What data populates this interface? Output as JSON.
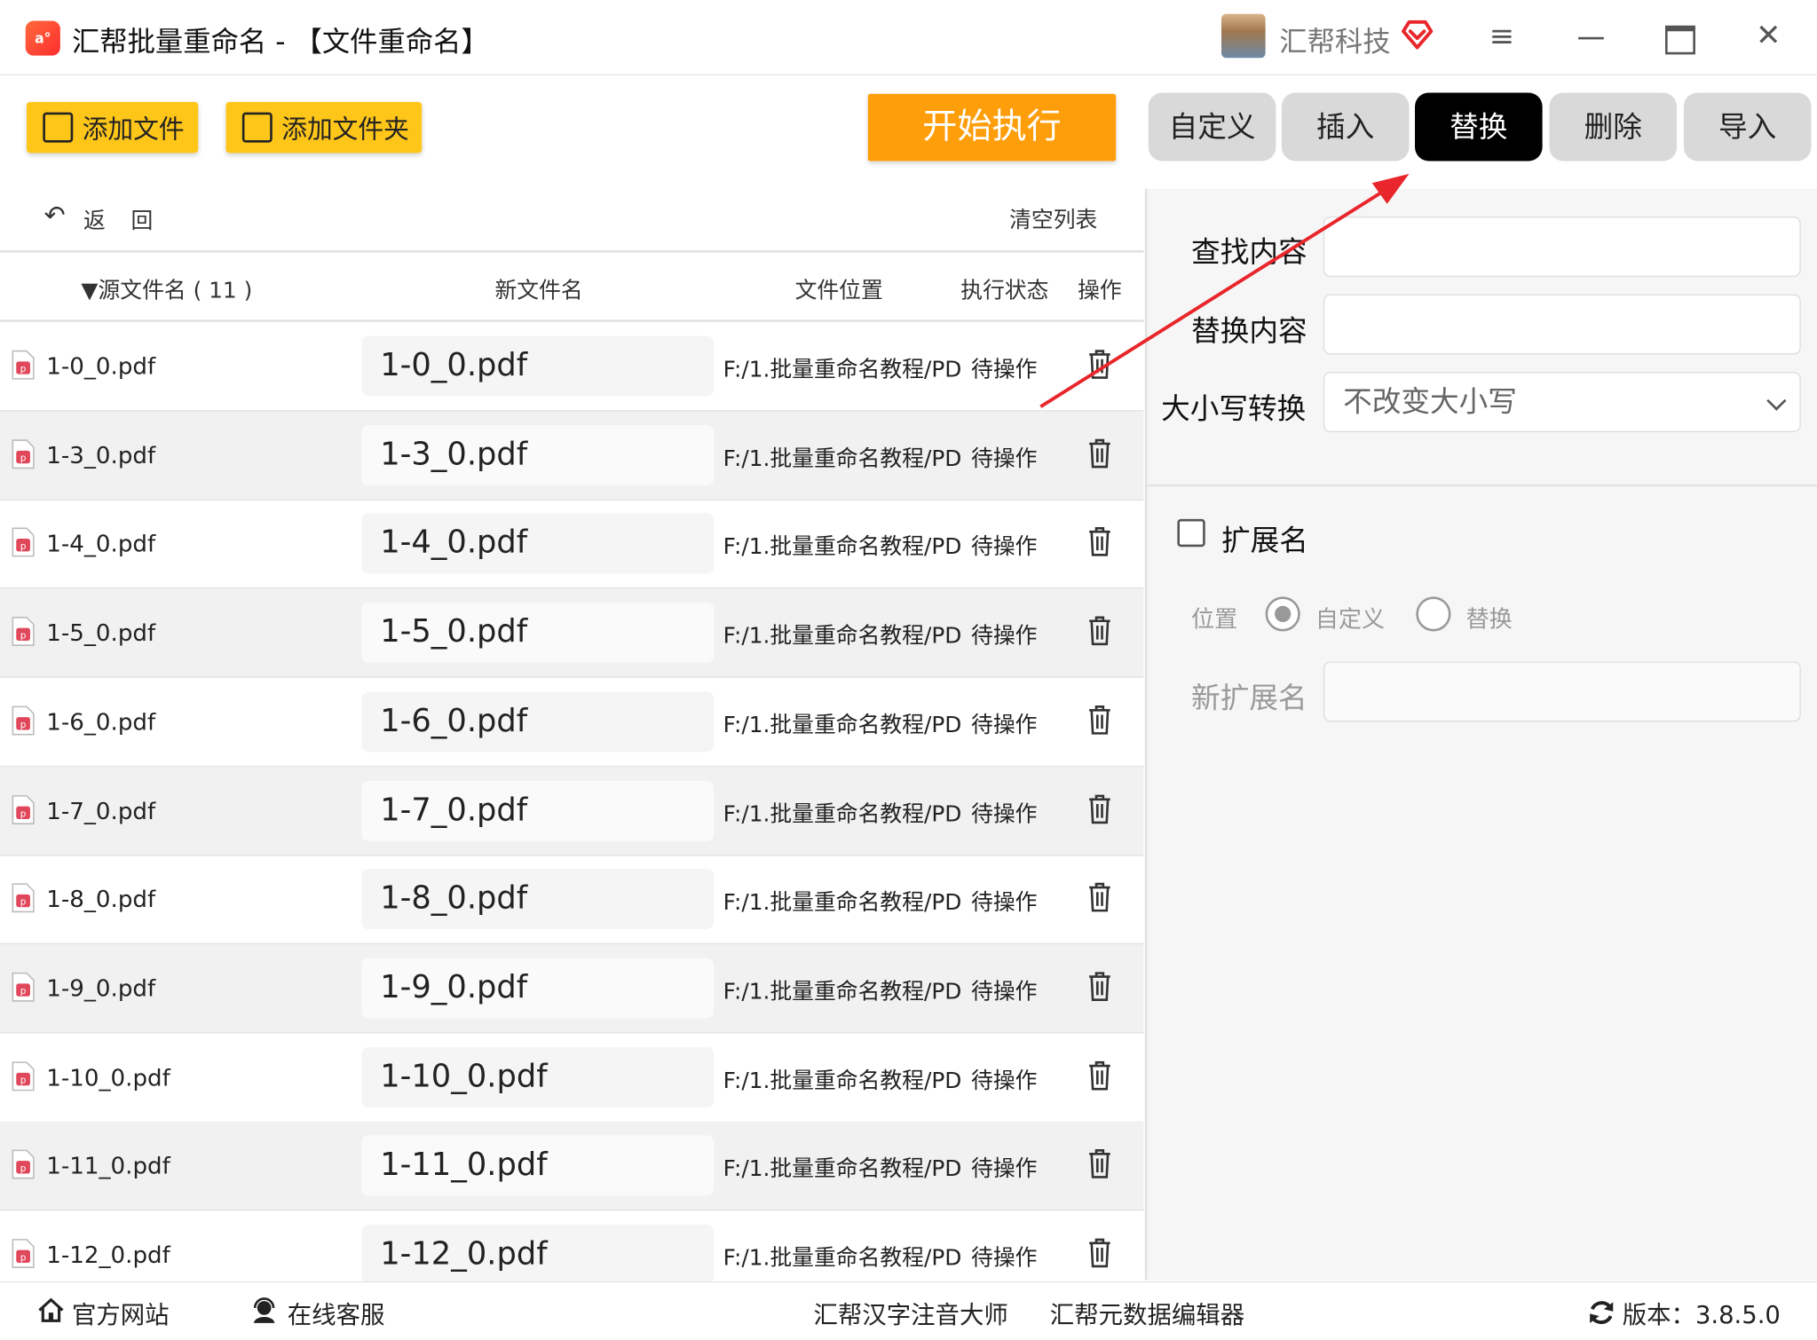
{
  "window": {
    "title": "汇帮批量重命名 - 【文件重命名】",
    "logo_text": "a°",
    "user_name": "汇帮科技"
  },
  "toolbar": {
    "add_file": "添加文件",
    "add_folder": "添加文件夹",
    "start": "开始执行"
  },
  "tabs": [
    "自定义",
    "插入",
    "替换",
    "删除",
    "导入"
  ],
  "active_tab": "替换",
  "list": {
    "back": "返回",
    "clear": "清空列表",
    "columns": {
      "source": "▼源文件名 ( 11 )",
      "new_name": "新文件名",
      "location": "文件位置",
      "status": "执行状态",
      "action": "操作"
    },
    "rows": [
      {
        "source": "1-0_0.pdf",
        "new_name": "1-0_0.pdf",
        "location": "F:/1.批量重命名教程/PD",
        "status": "待操作"
      },
      {
        "source": "1-3_0.pdf",
        "new_name": "1-3_0.pdf",
        "location": "F:/1.批量重命名教程/PD",
        "status": "待操作"
      },
      {
        "source": "1-4_0.pdf",
        "new_name": "1-4_0.pdf",
        "location": "F:/1.批量重命名教程/PD",
        "status": "待操作"
      },
      {
        "source": "1-5_0.pdf",
        "new_name": "1-5_0.pdf",
        "location": "F:/1.批量重命名教程/PD",
        "status": "待操作"
      },
      {
        "source": "1-6_0.pdf",
        "new_name": "1-6_0.pdf",
        "location": "F:/1.批量重命名教程/PD",
        "status": "待操作"
      },
      {
        "source": "1-7_0.pdf",
        "new_name": "1-7_0.pdf",
        "location": "F:/1.批量重命名教程/PD",
        "status": "待操作"
      },
      {
        "source": "1-8_0.pdf",
        "new_name": "1-8_0.pdf",
        "location": "F:/1.批量重命名教程/PD",
        "status": "待操作"
      },
      {
        "source": "1-9_0.pdf",
        "new_name": "1-9_0.pdf",
        "location": "F:/1.批量重命名教程/PD",
        "status": "待操作"
      },
      {
        "source": "1-10_0.pdf",
        "new_name": "1-10_0.pdf",
        "location": "F:/1.批量重命名教程/PD",
        "status": "待操作"
      },
      {
        "source": "1-11_0.pdf",
        "new_name": "1-11_0.pdf",
        "location": "F:/1.批量重命名教程/PD",
        "status": "待操作"
      },
      {
        "source": "1-12_0.pdf",
        "new_name": "1-12_0.pdf",
        "location": "F:/1.批量重命名教程/PD",
        "status": "待操作"
      }
    ]
  },
  "panel": {
    "find_label": "查找内容",
    "find_value": "",
    "replace_label": "替换内容",
    "replace_value": "",
    "case_label": "大小写转换",
    "case_value": "不改变大小写",
    "ext_label": "扩展名",
    "ext_checked": false,
    "position_label": "位置",
    "radio_custom": "自定义",
    "radio_replace": "替换",
    "new_ext_label": "新扩展名",
    "new_ext_value": ""
  },
  "footer": {
    "website": "官方网站",
    "support": "在线客服",
    "pinyin_app": "汇帮汉字注音大师",
    "metadata_app": "汇帮元数据编辑器",
    "version": "版本：3.8.5.0"
  },
  "colors": {
    "accent_yellow": "#ffc61a",
    "start_orange": "#ff9e0b",
    "active_tab": "#000000",
    "annotation_arrow": "#e8262b"
  }
}
